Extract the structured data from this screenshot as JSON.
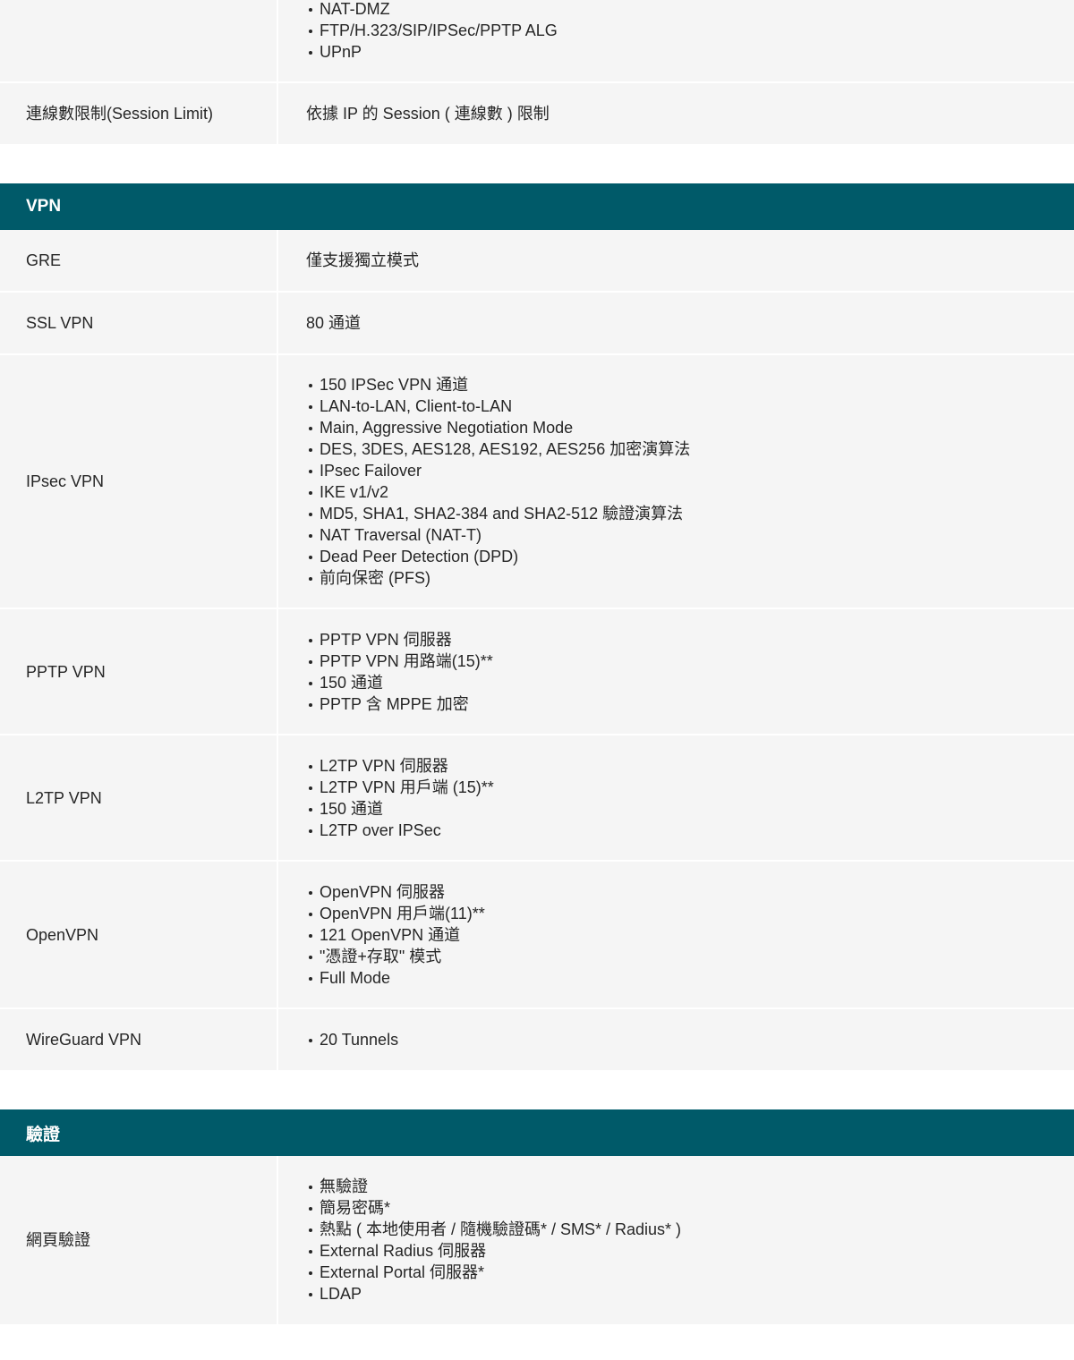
{
  "top_partial": {
    "items": [
      "NAT-DMZ",
      "FTP/H.323/SIP/IPSec/PPTP ALG",
      "UPnP"
    ]
  },
  "session": {
    "label": "連線數限制(Session Limit)",
    "value": "依據 IP 的 Session ( 連線數 ) 限制"
  },
  "vpn": {
    "header": "VPN",
    "gre": {
      "label": "GRE",
      "value": "僅支援獨立模式"
    },
    "ssl": {
      "label": "SSL VPN",
      "value": "80 通道"
    },
    "ipsec": {
      "label": "IPsec VPN",
      "items": [
        "150 IPSec VPN 通道",
        "LAN-to-LAN, Client-to-LAN",
        "Main, Aggressive Negotiation Mode",
        "DES, 3DES, AES128, AES192, AES256 加密演算法",
        "IPsec Failover",
        "IKE v1/v2",
        "MD5, SHA1, SHA2-384 and SHA2-512 驗證演算法",
        "NAT Traversal (NAT-T)",
        "Dead Peer Detection (DPD)",
        "前向保密 (PFS)"
      ]
    },
    "pptp": {
      "label": "PPTP VPN",
      "items": [
        "PPTP VPN 伺服器",
        "PPTP VPN 用路端(15)**",
        "150 通道",
        "PPTP 含 MPPE 加密"
      ]
    },
    "l2tp": {
      "label": "L2TP VPN",
      "items": [
        "L2TP VPN 伺服器",
        "L2TP VPN 用戶端 (15)**",
        "150 通道",
        "L2TP over IPSec"
      ]
    },
    "openvpn": {
      "label": "OpenVPN",
      "items": [
        "OpenVPN 伺服器",
        "OpenVPN 用戶端(11)**",
        "121 OpenVPN 通道",
        "\"憑證+存取\" 模式",
        "Full Mode"
      ]
    },
    "wireguard": {
      "label": "WireGuard VPN",
      "items": [
        "20 Tunnels"
      ]
    }
  },
  "auth": {
    "header": "驗證",
    "web": {
      "label": "網頁驗證",
      "items": [
        "無驗證",
        "簡易密碼*",
        "熱點 ( 本地使用者 / 隨機驗證碼* / SMS* / Radius* )",
        "External Radius 伺服器",
        "External Portal 伺服器*",
        "LDAP"
      ]
    }
  }
}
